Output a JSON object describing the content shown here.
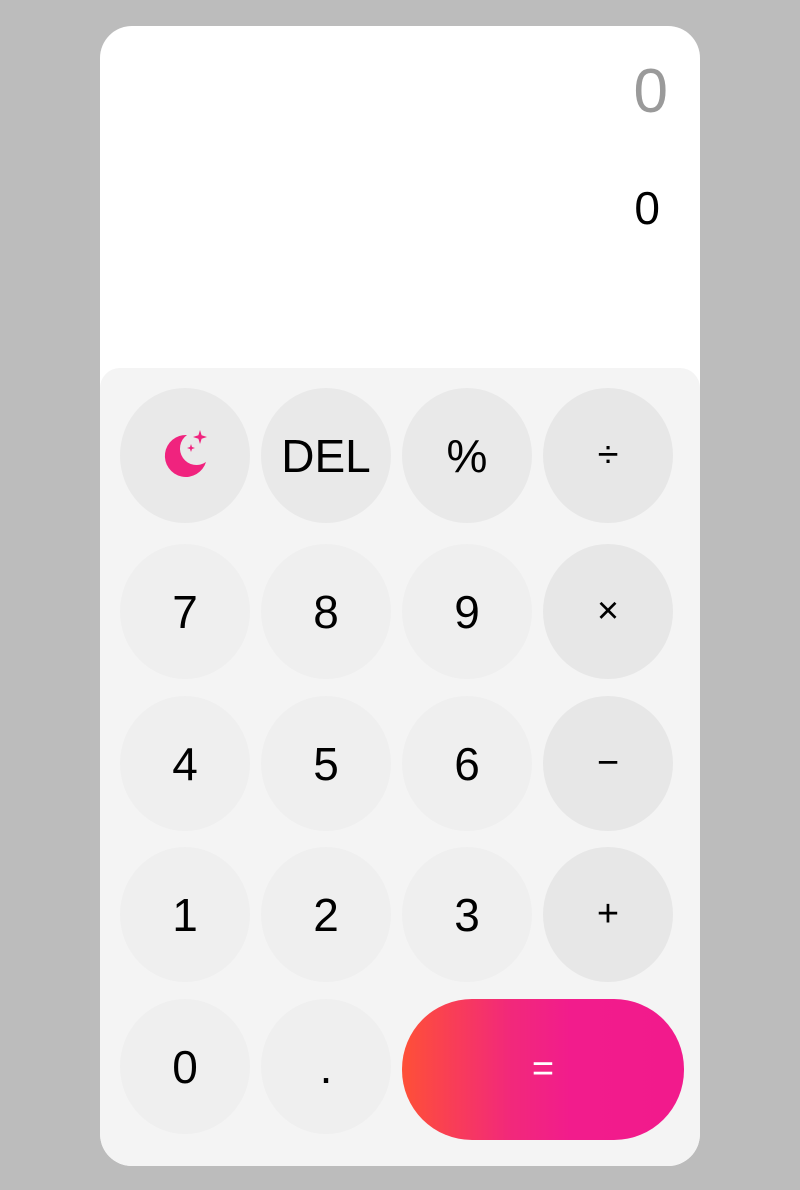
{
  "display": {
    "previous": "0",
    "current": "0"
  },
  "keys": {
    "theme_icon": "moon-stars-icon",
    "del": "DEL",
    "percent": "%",
    "divide": "÷",
    "seven": "7",
    "eight": "8",
    "nine": "9",
    "multiply": "×",
    "four": "4",
    "five": "5",
    "six": "6",
    "subtract": "−",
    "one": "1",
    "two": "2",
    "three": "3",
    "add": "+",
    "zero": "0",
    "decimal": ".",
    "equals": "="
  },
  "colors": {
    "accent_start": "#fe5037",
    "accent_end": "#f21a8c",
    "icon": "#f0237e",
    "background": "#bcbcbc",
    "keypad": "#f4f4f4"
  }
}
